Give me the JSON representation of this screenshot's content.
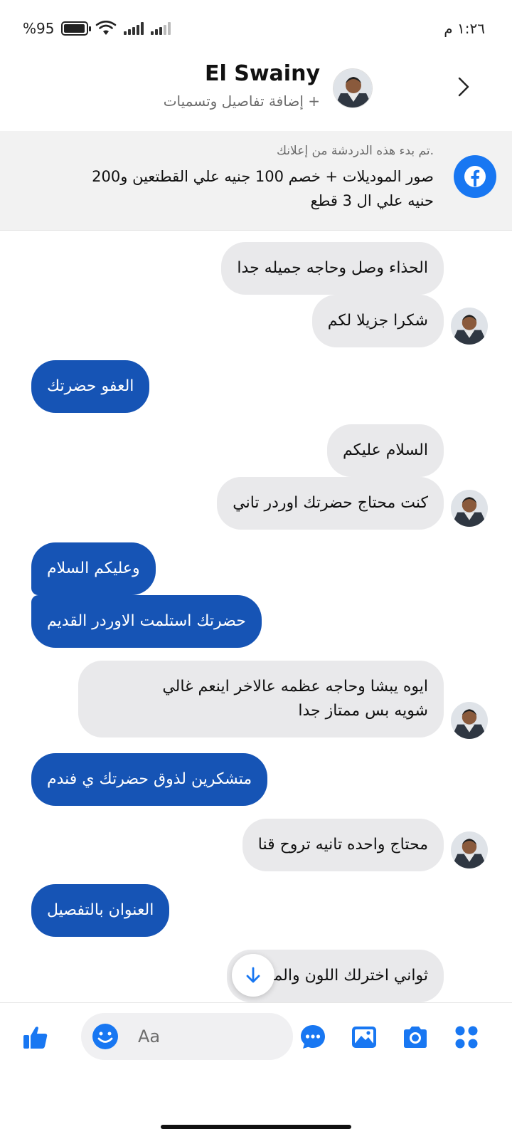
{
  "status_bar": {
    "battery": "%95",
    "battery_level": 0.95,
    "time": "١:٢٦ م"
  },
  "header": {
    "title": "El Swainy",
    "subtitle": "+ إضافة تفاصيل وتسميات"
  },
  "ad_banner": {
    "note": ".تم بدء هذه الدردشة من إعلانك",
    "text": "صور الموديلات +  خصم 100 جنيه علي القطتعين و200 حنيه علي ال 3 قطع"
  },
  "messages": [
    {
      "direction": "in",
      "text": "الحذاء وصل وحاجه جميله جدا",
      "avatar": false
    },
    {
      "direction": "in",
      "text": "شكرا جزيلا لكم",
      "avatar": true
    },
    {
      "direction": "out",
      "text": "العفو حضرتك"
    },
    {
      "direction": "in",
      "text": "السلام عليكم",
      "avatar": false
    },
    {
      "direction": "in",
      "text": "كنت محتاج حضرتك اوردر تاني",
      "avatar": true
    },
    {
      "direction": "out",
      "text": "وعليكم السلام"
    },
    {
      "direction": "out",
      "text": "حضرتك استلمت الاوردر القديم"
    },
    {
      "direction": "in",
      "lines": [
        "ايوه يبشا وحاجه عظمه عالاخر اينعم غالي",
        "شويه بس ممتاز جدا"
      ],
      "avatar": true
    },
    {
      "direction": "out",
      "text": "متشكرين لذوق حضرتك ي فندم"
    },
    {
      "direction": "in",
      "text": "محتاج واحده تانيه تروح قنا",
      "avatar": true
    },
    {
      "direction": "out",
      "text": "العنوان بالتفصيل"
    },
    {
      "direction": "in",
      "text": "ثواني اخترلك اللون والمقاس",
      "avatar": false
    }
  ],
  "composer": {
    "placeholder": "Aa"
  },
  "colors": {
    "accent": "#1877f2",
    "outgoing_bubble": "#1654b5",
    "incoming_bubble": "#e9e9eb"
  },
  "icons": [
    "like-icon",
    "emoji-icon",
    "chat-bubble-icon",
    "gallery-icon",
    "camera-icon",
    "apps-grid-icon",
    "facebook-icon",
    "back-chevron-icon",
    "arrow-down-icon"
  ]
}
